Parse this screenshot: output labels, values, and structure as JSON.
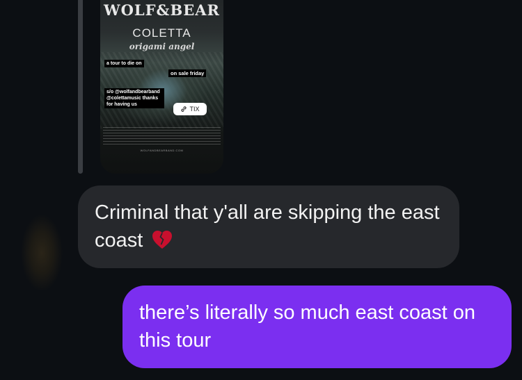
{
  "story": {
    "band_logo": "WOLF&BEAR",
    "band_2": "COLETTA",
    "band_3": "origami angel",
    "sticker_tour": "a tour to die on",
    "sticker_sale": "on sale friday",
    "sticker_shoutout": "s/o @wolfandbearband @colettamusic thanks for having us",
    "tix_label": "TIX",
    "footer_url": "WOLFANDBEARBAND.COM"
  },
  "messages": [
    {
      "direction": "incoming",
      "text": "Criminal that y'all are skipping the east coast",
      "emoji": "broken-heart",
      "bubble_color": "#26282c"
    },
    {
      "direction": "outgoing",
      "text": "there’s literally so much east coast on this tour",
      "bubble_color": "#7b2ff0"
    }
  ],
  "colors": {
    "background": "#0c0f13",
    "incoming_bubble": "#26282c",
    "outgoing_bubble": "#7b2ff0"
  }
}
